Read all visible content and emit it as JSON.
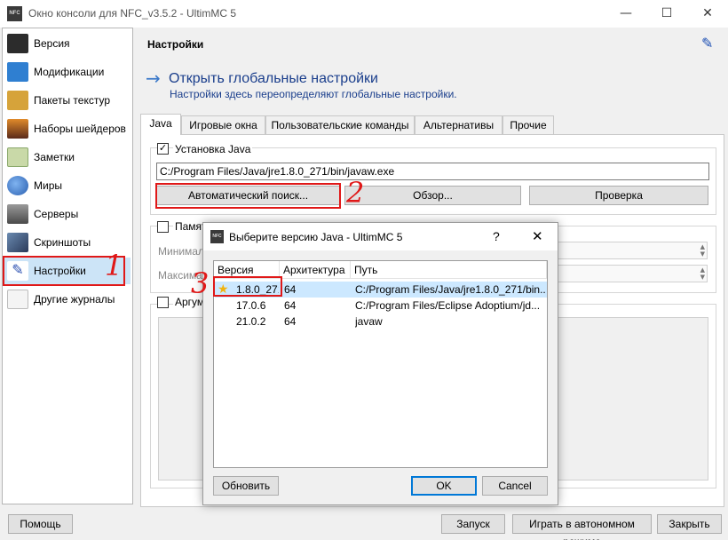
{
  "window": {
    "title": "Окно консоли для NFC_v3.5.2 - UltimMC 5",
    "app_icon_text": "NFC",
    "minimize": "—",
    "maximize": "☐",
    "close": "✕"
  },
  "sidebar": {
    "items": [
      {
        "label": "Версия",
        "icon": "nfc-icon",
        "color": "#2c2c2c"
      },
      {
        "label": "Модификации",
        "icon": "puzzle-icon",
        "color": "#2f7fd1"
      },
      {
        "label": "Пакеты текстур",
        "icon": "paint-icon",
        "color": "#d6a33a"
      },
      {
        "label": "Наборы шейдеров",
        "icon": "landscape-icon",
        "color": "#c45a2b"
      },
      {
        "label": "Заметки",
        "icon": "notes-icon",
        "color": "#8aa86b"
      },
      {
        "label": "Миры",
        "icon": "globe-icon",
        "color": "#3a7bd5"
      },
      {
        "label": "Серверы",
        "icon": "server-icon",
        "color": "#6a6a6a"
      },
      {
        "label": "Скриншоты",
        "icon": "screenshot-icon",
        "color": "#4a6a8a"
      },
      {
        "label": "Настройки",
        "icon": "settings-icon",
        "color": "#2a4fb0"
      },
      {
        "label": "Другие журналы",
        "icon": "logs-icon",
        "color": "#9a9a9a"
      }
    ],
    "active_index": 8
  },
  "header": {
    "title": "Настройки",
    "global_link": "Открыть глобальные настройки",
    "global_sub": "Настройки здесь переопределяют глобальные настройки."
  },
  "tabs": [
    "Java",
    "Игровые окна",
    "Пользовательские команды",
    "Альтернативы",
    "Прочие"
  ],
  "java": {
    "install_check": "Установка Java",
    "install_checked": true,
    "path": "C:/Program Files/Java/jre1.8.0_271/bin/javaw.exe",
    "auto_search": "Автоматический поиск...",
    "browse": "Обзор...",
    "test": "Проверка",
    "memory_check": "Памят",
    "min_label": "Минимал",
    "max_label": "Максимал",
    "args_check": "Аргуме"
  },
  "dialog": {
    "title": "Выберите версию Java - UltimMC 5",
    "help": "?",
    "close": "✕",
    "columns": [
      "Версия",
      "Архитектура",
      "Путь"
    ],
    "rows": [
      {
        "version": "1.8.0_271",
        "arch": "64",
        "path": "C:/Program Files/Java/jre1.8.0_271/bin...",
        "recommended": true
      },
      {
        "version": "17.0.6",
        "arch": "64",
        "path": "C:/Program Files/Eclipse Adoptium/jd..."
      },
      {
        "version": "21.0.2",
        "arch": "64",
        "path": "javaw"
      }
    ],
    "selected_index": 0,
    "refresh": "Обновить",
    "ok": "OK",
    "cancel": "Cancel"
  },
  "footer": {
    "help": "Помощь",
    "launch": "Запуск",
    "offline": "Играть в автономном режиме",
    "close": "Закрыть"
  },
  "annotations": {
    "one": "1",
    "two": "2",
    "three": "3",
    "color": "#e01818"
  }
}
